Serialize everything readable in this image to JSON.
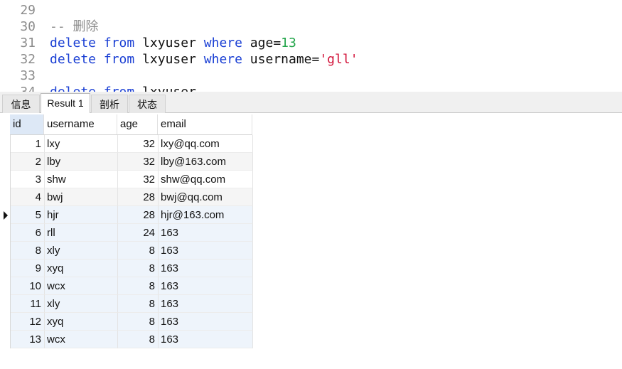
{
  "editor": {
    "lines": [
      {
        "num": "29",
        "tokens": []
      },
      {
        "num": "30",
        "tokens": [
          {
            "t": "-- 删除",
            "c": "cmt"
          }
        ]
      },
      {
        "num": "31",
        "tokens": [
          {
            "t": "delete",
            "c": "kw"
          },
          {
            "t": " ",
            "c": "txt"
          },
          {
            "t": "from",
            "c": "kw"
          },
          {
            "t": " lxyuser ",
            "c": "txt"
          },
          {
            "t": "where",
            "c": "kw"
          },
          {
            "t": " age=",
            "c": "txt"
          },
          {
            "t": "13",
            "c": "num"
          }
        ]
      },
      {
        "num": "32",
        "tokens": [
          {
            "t": "delete",
            "c": "kw"
          },
          {
            "t": " ",
            "c": "txt"
          },
          {
            "t": "from",
            "c": "kw"
          },
          {
            "t": " lxyuser ",
            "c": "txt"
          },
          {
            "t": "where",
            "c": "kw"
          },
          {
            "t": " username=",
            "c": "txt"
          },
          {
            "t": "'gll'",
            "c": "str"
          }
        ]
      },
      {
        "num": "33",
        "tokens": []
      },
      {
        "num": "34",
        "tokens": [
          {
            "t": "delete",
            "c": "kw"
          },
          {
            "t": " ",
            "c": "txt"
          },
          {
            "t": "from",
            "c": "kw"
          },
          {
            "t": " lxyuser",
            "c": "txt"
          }
        ]
      }
    ]
  },
  "tabs": [
    {
      "label": "信息",
      "active": false
    },
    {
      "label": "Result 1",
      "active": true
    },
    {
      "label": "剖析",
      "active": false
    },
    {
      "label": "状态",
      "active": false
    }
  ],
  "result": {
    "columns": [
      "id",
      "username",
      "age",
      "email"
    ],
    "selected_column": "id",
    "current_row": 4,
    "rows": [
      [
        "1",
        "lxy",
        "32",
        "lxy@qq.com"
      ],
      [
        "2",
        "lby",
        "32",
        "lby@163.com"
      ],
      [
        "3",
        "shw",
        "32",
        "shw@qq.com"
      ],
      [
        "4",
        "bwj",
        "28",
        "bwj@qq.com"
      ],
      [
        "5",
        "hjr",
        "28",
        "hjr@163.com"
      ],
      [
        "6",
        "rll",
        "24",
        "163"
      ],
      [
        "8",
        "xly",
        "8",
        "163"
      ],
      [
        "9",
        "xyq",
        "8",
        "163"
      ],
      [
        "10",
        "wcx",
        "8",
        "163"
      ],
      [
        "11",
        "xly",
        "8",
        "163"
      ],
      [
        "12",
        "xyq",
        "8",
        "163"
      ],
      [
        "13",
        "wcx",
        "8",
        "163"
      ]
    ]
  },
  "colors": {
    "keyword": "#1a3fd4",
    "number": "#22a54a",
    "string": "#d2143a",
    "comment": "#8c8c8c",
    "row_alt": "#f5f5f5",
    "row_highlight": "#eef4fb",
    "selected_header": "#dde8f6"
  }
}
